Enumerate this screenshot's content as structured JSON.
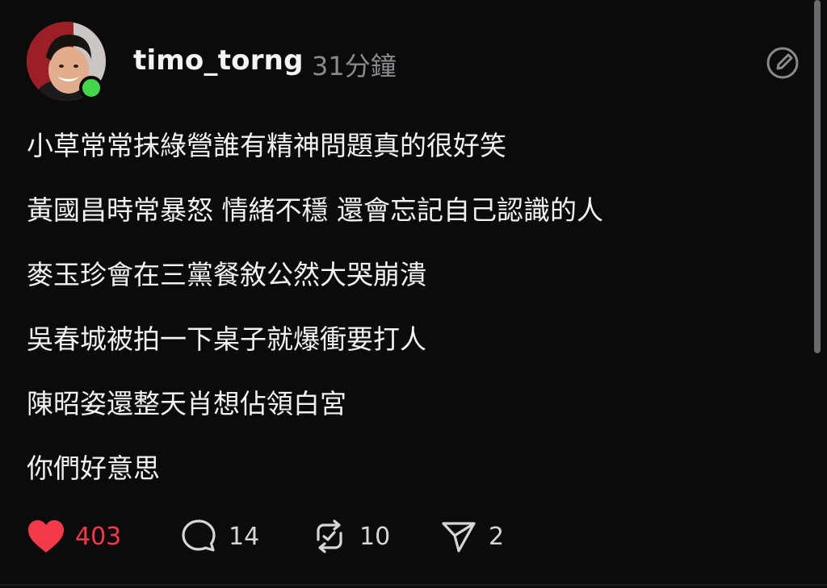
{
  "post": {
    "username": "timo_torng",
    "time": "31分鐘",
    "lines": [
      "小草常常抹綠營誰有精神問題真的很好笑",
      "黃國昌時常暴怒 情緒不穩 還會忘記自己認識的人",
      "麥玉珍會在三黨餐敘公然大哭崩潰",
      "吳春城被拍一下桌子就爆衝要打人",
      "陳昭姿還整天肖想佔領白宮",
      "你們好意思"
    ],
    "actions": {
      "likes": "403",
      "comments": "14",
      "reposts": "10",
      "shares": "2"
    }
  },
  "icons": {
    "avatar": "avatar",
    "online": "online-status-dot-icon",
    "more": "edit-circle-icon",
    "like": "heart-icon",
    "comment": "comment-bubble-icon",
    "repost": "repost-icon",
    "share": "send-arrow-icon"
  },
  "colors": {
    "background": "#0b0b0c",
    "like_accent": "#f33a4a",
    "online": "#43d64a",
    "muted": "#8a8a8e"
  }
}
